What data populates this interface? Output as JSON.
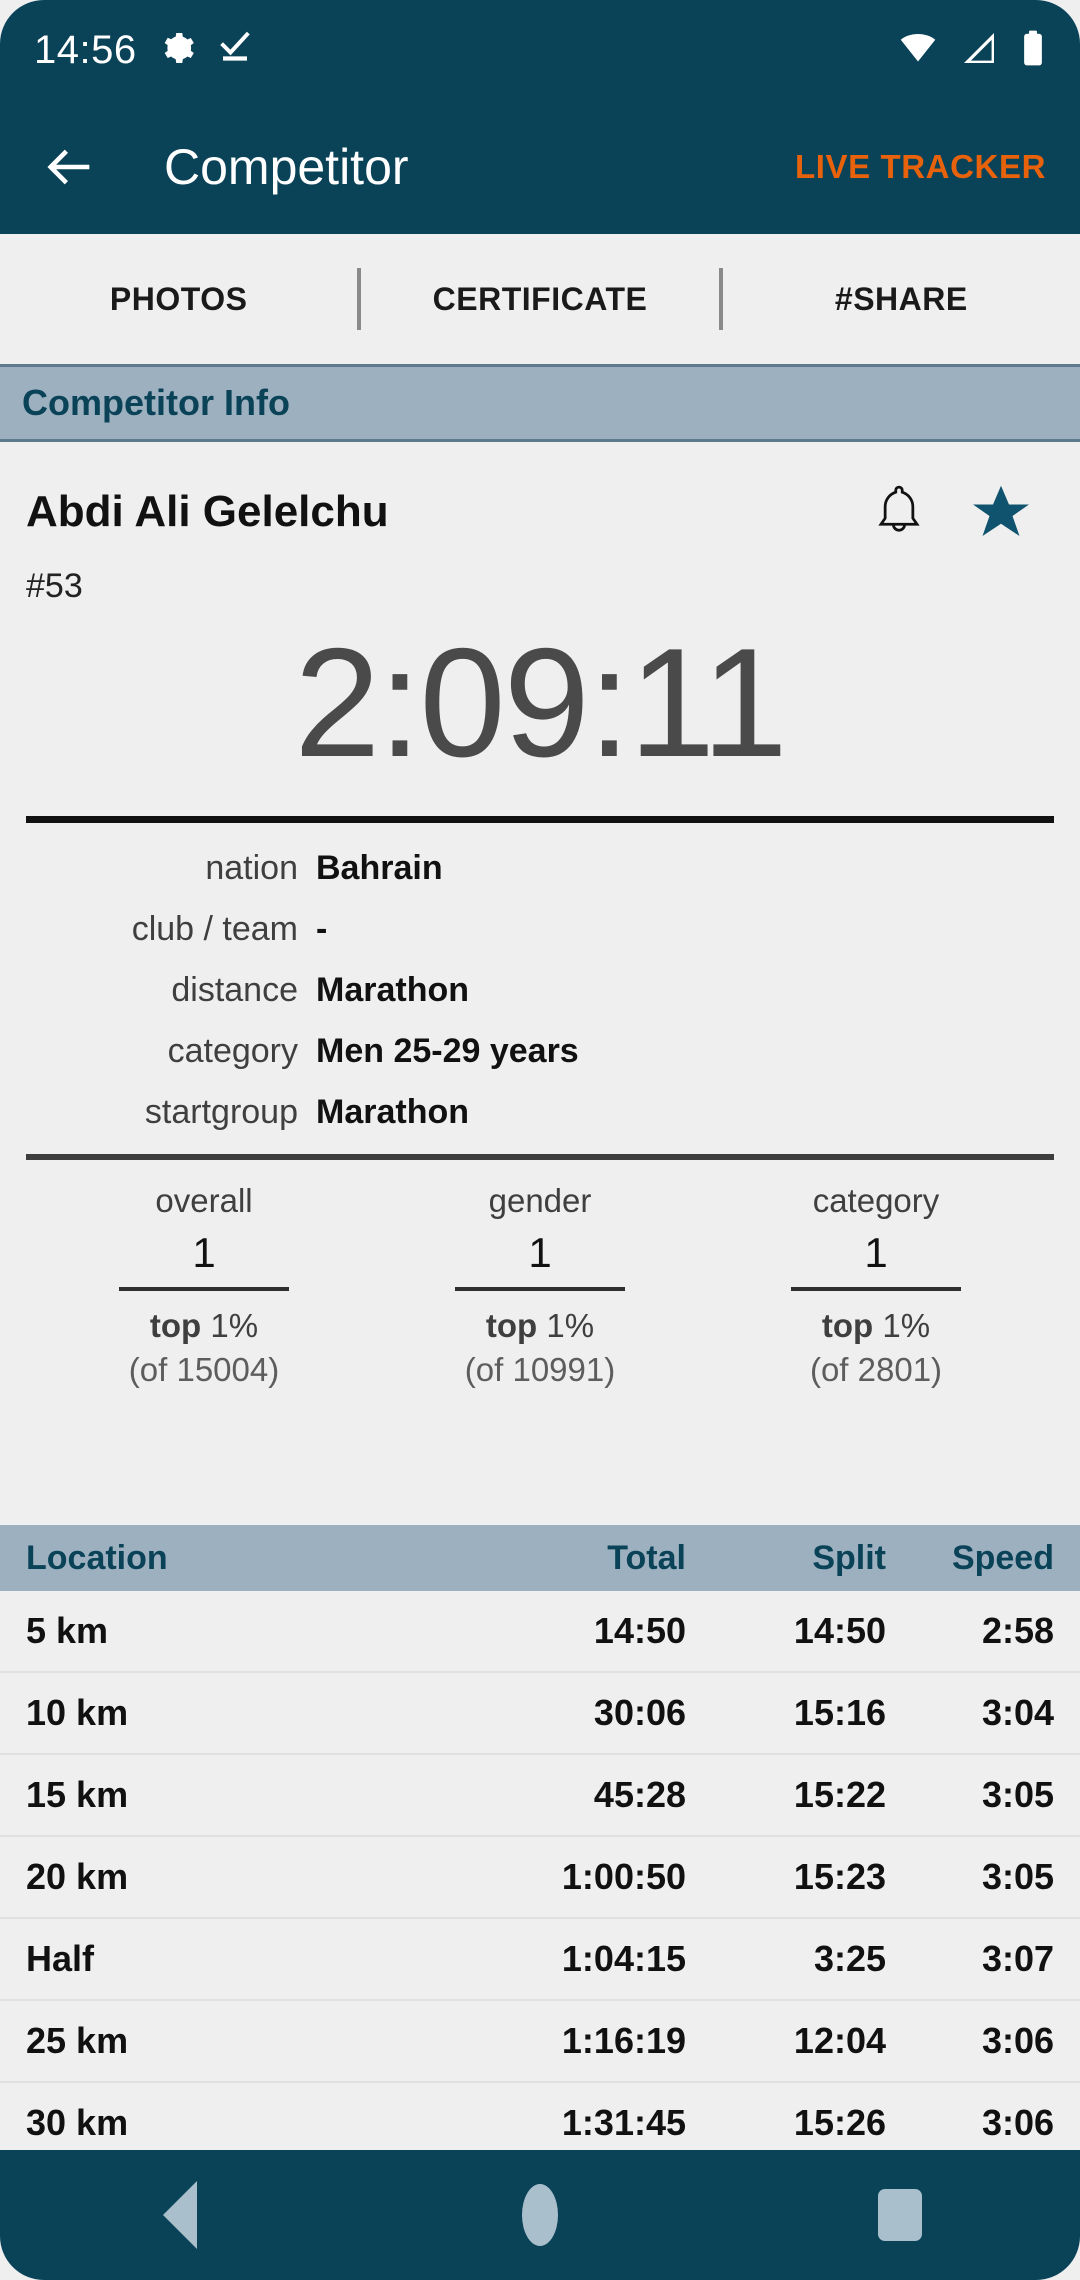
{
  "statusbar": {
    "clock": "14:56",
    "icons": [
      "gear-icon",
      "checkmark-underline-icon"
    ],
    "right_icons": [
      "wifi-icon",
      "cellular-signal-icon",
      "battery-icon"
    ]
  },
  "appbar": {
    "back": "back-arrow-icon",
    "title": "Competitor",
    "action_label": "LIVE TRACKER",
    "accent_color": "#e8620c",
    "background_color": "#0a4257"
  },
  "tabs": [
    {
      "label": "PHOTOS"
    },
    {
      "label": "CERTIFICATE"
    },
    {
      "label": "#SHARE"
    }
  ],
  "section": {
    "title": "Competitor Info",
    "background_color": "#9db0c0",
    "text_color": "#0a4257"
  },
  "competitor": {
    "name": "Abdi Ali Gelelchu",
    "bib": "#53",
    "finish_time": "2:09:11",
    "notify_icon": "bell-icon",
    "favorite_icon": "star-icon",
    "favorite_color": "#10536e",
    "details": [
      {
        "label": "nation",
        "value": "Bahrain"
      },
      {
        "label": "club / team",
        "value": "-"
      },
      {
        "label": "distance",
        "value": "Marathon"
      },
      {
        "label": "category",
        "value": "Men 25-29 years"
      },
      {
        "label": "startgroup",
        "value": "Marathon"
      }
    ],
    "rankings": [
      {
        "label": "overall",
        "place": "1",
        "top": "top ",
        "top_pct": "1%",
        "of": "(of 15004)"
      },
      {
        "label": "gender",
        "place": "1",
        "top": "top ",
        "top_pct": "1%",
        "of": "(of 10991)"
      },
      {
        "label": "category",
        "place": "1",
        "top": "top ",
        "top_pct": "1%",
        "of": "(of 2801)"
      }
    ]
  },
  "splits": {
    "headers": {
      "location": "Location",
      "total": "Total",
      "split": "Split",
      "speed": "Speed"
    },
    "rows": [
      {
        "location": "5 km",
        "total": "14:50",
        "split": "14:50",
        "speed": "2:58"
      },
      {
        "location": "10 km",
        "total": "30:06",
        "split": "15:16",
        "speed": "3:04"
      },
      {
        "location": "15 km",
        "total": "45:28",
        "split": "15:22",
        "speed": "3:05"
      },
      {
        "location": "20 km",
        "total": "1:00:50",
        "split": "15:23",
        "speed": "3:05"
      },
      {
        "location": "Half",
        "total": "1:04:15",
        "split": "3:25",
        "speed": "3:07"
      },
      {
        "location": "25 km",
        "total": "1:16:19",
        "split": "12:04",
        "speed": "3:06"
      },
      {
        "location": "30 km",
        "total": "1:31:45",
        "split": "15:26",
        "speed": "3:06"
      }
    ]
  },
  "navbar": {
    "back": "triangle-back-icon",
    "home": "circle-home-icon",
    "recents": "square-recents-icon"
  }
}
